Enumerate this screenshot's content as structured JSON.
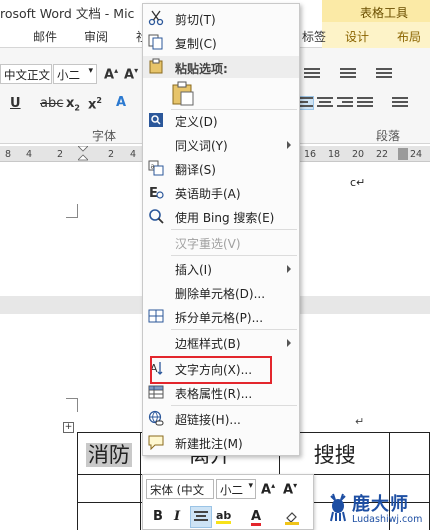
{
  "window": {
    "title": "rosoft Word 文档 - Mic",
    "contextual_group": "表格工具"
  },
  "tabs": {
    "mail": "邮件",
    "review": "审阅",
    "partial_view": "社",
    "label_tab": "标签",
    "design": "设计",
    "layout": "布局"
  },
  "ribbon": {
    "font_name": "中文正文",
    "font_size": "小二",
    "font_group_label": "字体",
    "paragraph_group_label": "段落"
  },
  "ruler": {
    "left_numbers": [
      "8",
      "4",
      "2",
      "2",
      "4"
    ],
    "right_numbers": [
      "16",
      "18",
      "20",
      "22",
      "24"
    ]
  },
  "document": {
    "top_text": "c↵",
    "para_mark": "↵",
    "move_handle": "+",
    "cells": {
      "xiaofang": "消防",
      "liankai": "离开",
      "sousou": "搜搜"
    }
  },
  "context_menu": {
    "items": [
      {
        "label": "剪切(T)",
        "icon": "scissors-icon",
        "disabled": false,
        "submenu": false
      },
      {
        "label": "复制(C)",
        "icon": "copy-icon",
        "disabled": false,
        "submenu": false
      },
      {
        "label": "定义(D)",
        "icon": "define-icon",
        "disabled": false,
        "submenu": false
      },
      {
        "label": "同义词(Y)",
        "icon": "",
        "disabled": false,
        "submenu": true
      },
      {
        "label": "翻译(S)",
        "icon": "translate-icon",
        "disabled": false,
        "submenu": false
      },
      {
        "label": "英语助手(A)",
        "icon": "english-assistant-icon",
        "disabled": false,
        "submenu": false
      },
      {
        "label": "使用 Bing 搜索(E)",
        "icon": "search-icon",
        "disabled": false,
        "submenu": false
      },
      {
        "label": "汉字重选(V)",
        "icon": "",
        "disabled": true,
        "submenu": false
      },
      {
        "label": "插入(I)",
        "icon": "",
        "disabled": false,
        "submenu": true
      },
      {
        "label": "删除单元格(D)...",
        "icon": "",
        "disabled": false,
        "submenu": false
      },
      {
        "label": "拆分单元格(P)...",
        "icon": "split-cells-icon",
        "disabled": false,
        "submenu": false
      },
      {
        "label": "边框样式(B)",
        "icon": "",
        "disabled": false,
        "submenu": true
      },
      {
        "label": "文字方向(X)...",
        "icon": "text-direction-icon",
        "disabled": false,
        "submenu": false
      },
      {
        "label": "表格属性(R)...",
        "icon": "table-properties-icon",
        "disabled": false,
        "submenu": false
      },
      {
        "label": "超链接(H)...",
        "icon": "hyperlink-icon",
        "disabled": false,
        "submenu": false
      },
      {
        "label": "新建批注(M)",
        "icon": "new-comment-icon",
        "disabled": false,
        "submenu": false
      }
    ],
    "paste_header": "粘贴选项:",
    "highlighted_item": "文字方向(X)..."
  },
  "mini_toolbar": {
    "font_name": "宋体 (中文",
    "font_size": "小二"
  },
  "watermark": {
    "title": "鹿大师",
    "url": "Ludashiwj.com"
  },
  "colors": {
    "accent_blue": "#2b579a",
    "highlight_red": "#e3262d",
    "contextual_yellow": "#fbeaa6",
    "logo_blue": "#1e4fa3"
  }
}
